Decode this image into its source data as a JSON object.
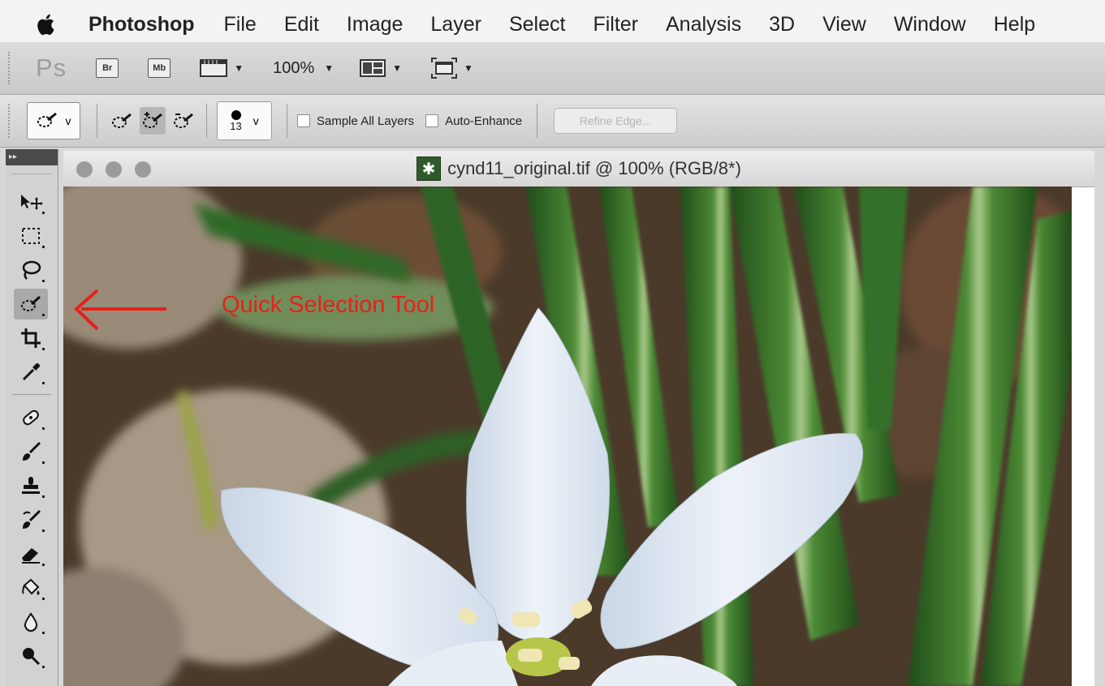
{
  "menubar": {
    "apple_icon": "apple-icon",
    "items": [
      "Photoshop",
      "File",
      "Edit",
      "Image",
      "Layer",
      "Select",
      "Filter",
      "Analysis",
      "3D",
      "View",
      "Window",
      "Help"
    ]
  },
  "appbar": {
    "logo": "Ps",
    "bridge": "Br",
    "minibridge": "Mb",
    "zoom": "100%"
  },
  "options": {
    "brush_size": "13",
    "preset_caret": "v",
    "brush_caret": "v",
    "sample_all_layers": "Sample All Layers",
    "auto_enhance": "Auto-Enhance",
    "refine_edge": "Refine Edge..."
  },
  "document": {
    "title": "cynd11_original.tif @ 100% (RGB/8*)"
  },
  "annotation": {
    "label": "Quick Selection Tool",
    "color": "#e8201a"
  },
  "tools": [
    "move-tool-icon",
    "marquee-tool-icon",
    "lasso-tool-icon",
    "quick-selection-tool-icon",
    "crop-tool-icon",
    "eyedropper-tool-icon",
    "healing-brush-icon",
    "brush-tool-icon",
    "clone-stamp-icon",
    "history-brush-icon",
    "eraser-icon",
    "paint-bucket-icon",
    "blur-tool-icon",
    "dodge-tool-icon"
  ]
}
